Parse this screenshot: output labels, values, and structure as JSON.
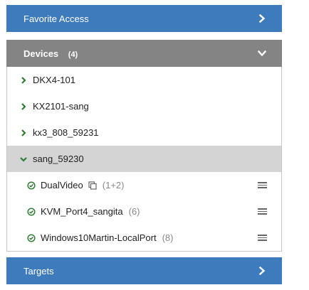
{
  "favorite_access": {
    "label": "Favorite Access"
  },
  "devices": {
    "label": "Devices",
    "count": "(4)",
    "items": [
      {
        "label": "DKX4-101"
      },
      {
        "label": "KX2101-sang"
      },
      {
        "label": "kx3_808_59231"
      },
      {
        "label": "sang_59230",
        "channels": [
          {
            "label": "DualVideo",
            "count": "(1+2)"
          },
          {
            "label": "KVM_Port4_sangita",
            "count": "(6)"
          },
          {
            "label": "Windows10Martin-LocalPort",
            "count": "(8)"
          }
        ]
      }
    ]
  },
  "targets": {
    "label": "Targets"
  },
  "colors": {
    "accent_blue": "#3e7bbd",
    "header_gray": "#848484",
    "chevron_green": "#2e7d32",
    "selected_row": "#d4d4d4"
  }
}
